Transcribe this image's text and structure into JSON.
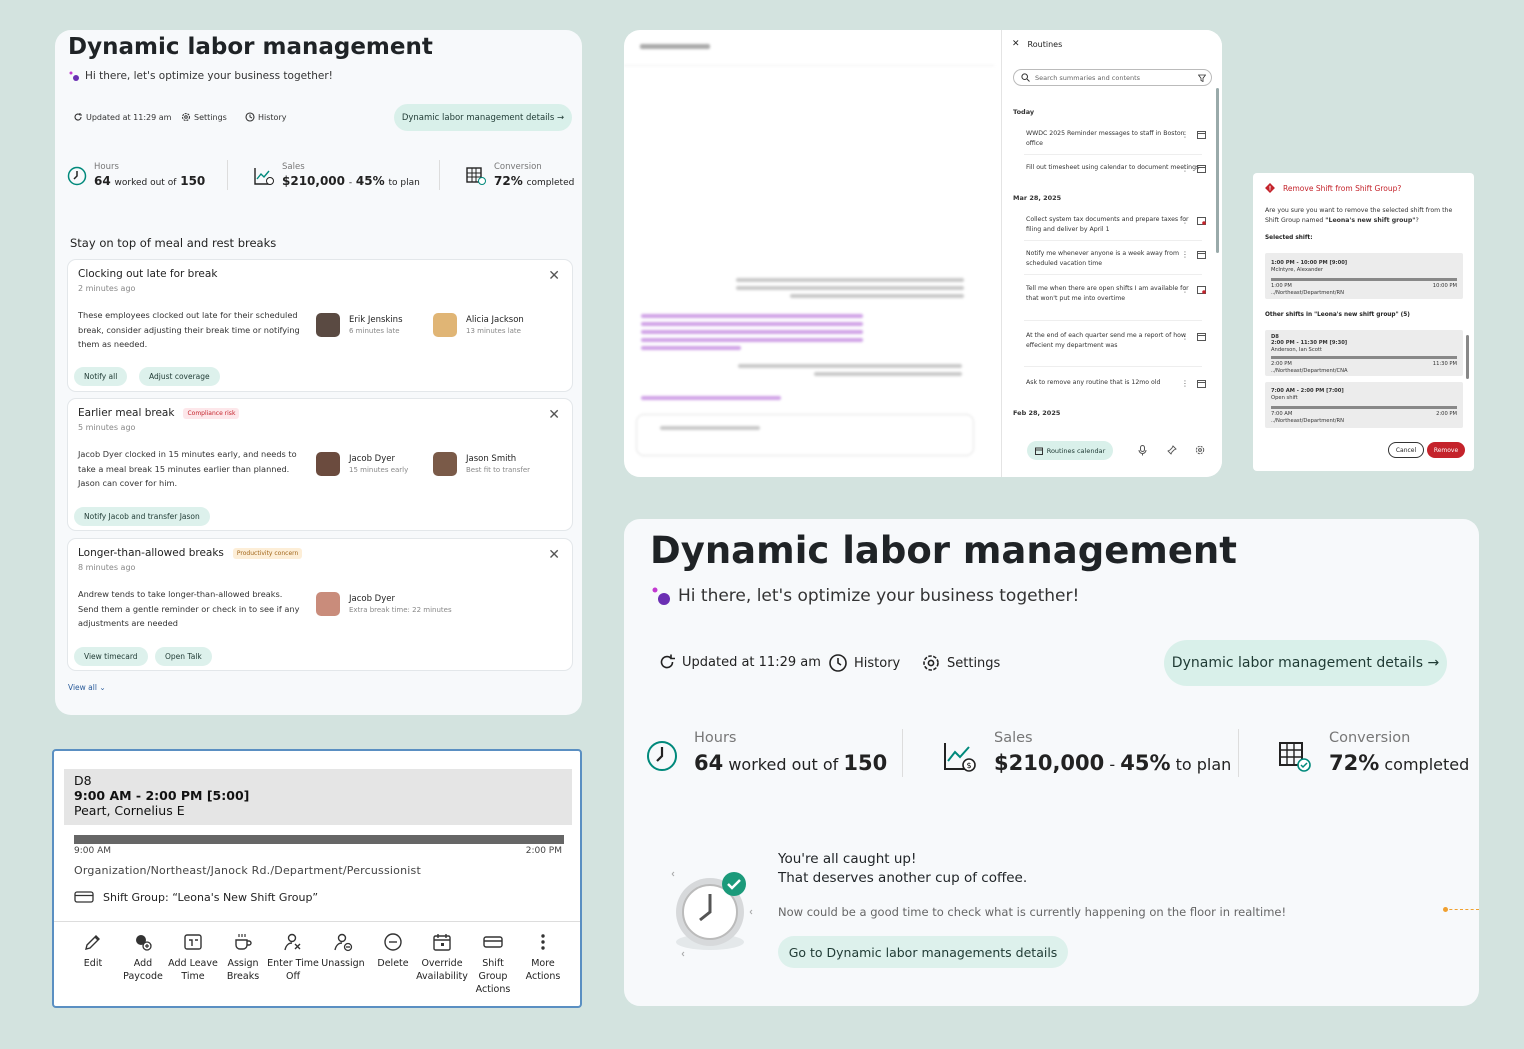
{
  "colors": {
    "accent_mint": "#d9f0ea",
    "brand_purple": "#6b2fb3",
    "danger": "#c4232b",
    "teal": "#00897b"
  },
  "card1": {
    "title": "Dynamic labor management",
    "subtitle": "Hi there, let's optimize your business together!",
    "toolbar": {
      "updated": "Updated at 11:29 am",
      "settings": "Settings",
      "history": "History",
      "details_button": "Dynamic labor management details"
    },
    "stats": {
      "hours": {
        "label": "Hours",
        "value": "64",
        "middle": "worked out of",
        "total": "150"
      },
      "sales": {
        "label": "Sales",
        "value": "$210,000",
        "sep": "-",
        "pct": "45%",
        "suffix": "to plan"
      },
      "conversion": {
        "label": "Conversion",
        "value": "72%",
        "suffix": "completed"
      }
    },
    "section_title": "Stay on top of meal and rest breaks",
    "alerts": [
      {
        "title": "Clocking out late for break",
        "tag": "",
        "time": "2 minutes ago",
        "desc": "These employees clocked out late for their scheduled break, consider adjusting their break time or notifying them as needed.",
        "people": [
          {
            "name": "Erik Jenskins",
            "detail": "6 minutes late"
          },
          {
            "name": "Alicia Jackson",
            "detail": "13 minutes late"
          }
        ],
        "actions": [
          "Notify all",
          "Adjust coverage"
        ]
      },
      {
        "title": "Earlier meal break",
        "tag": "Compliance risk",
        "time": "5 minutes ago",
        "desc": "Jacob Dyer clocked in 15 minutes early, and needs to take a meal break 15 minutes earlier than planned. Jason can cover for him.",
        "people": [
          {
            "name": "Jacob Dyer",
            "detail": "15 minutes early"
          },
          {
            "name": "Jason Smith",
            "detail": "Best fit to transfer"
          }
        ],
        "actions": [
          "Notify Jacob and transfer Jason"
        ]
      },
      {
        "title": "Longer-than-allowed breaks",
        "tag": "Productivity concern",
        "time": "8 minutes ago",
        "desc": "Andrew tends to take longer-than-allowed breaks. Send them a gentle reminder or check in to see if any adjustments are needed",
        "people": [
          {
            "name": "Jacob Dyer",
            "detail": "Extra break time: 22 minutes"
          }
        ],
        "actions": [
          "View timecard",
          "Open Talk"
        ]
      }
    ],
    "view_all": "View all"
  },
  "card2": {
    "panel_title": "Routines",
    "search_placeholder": "Search summaries and contents",
    "groups": [
      {
        "label": "Today",
        "items": [
          "WWDC 2025 Reminder messages to staff in Boston office",
          "Fill out timesheet using calendar to document meetings"
        ]
      },
      {
        "label": "Mar 28, 2025",
        "items": [
          "Collect system tax documents and prepare taxes for filing and deliver by April 1",
          "Notify me whenever anyone is a week away from scheduled vacation time",
          "Tell me when there are open shifts I am available for that won't put me into overtime",
          "At the end of each quarter send me a report of how effecient my department was",
          "Ask to remove any routine that is 12mo old"
        ]
      },
      {
        "label": "Feb 28, 2025",
        "items": []
      }
    ],
    "calendar_button": "Routines calendar"
  },
  "dialog": {
    "title": "Remove Shift from Shift Group?",
    "body_prefix": "Are you sure you want to remove the selected shift from the Shift Group named ",
    "body_group": "\"Leona's new shift group\"",
    "body_suffix": "?",
    "selected_label": "Selected shift:",
    "selected": {
      "time": "1:00 PM - 10:00 PM [9:00]",
      "name": "McIntyre, Alexander",
      "start": "1:00 PM",
      "end": "10:00 PM",
      "path": "../Northeast/Department/RN"
    },
    "other_label": "Other shifts in \"Leona's new shift group\" (5)",
    "others": [
      {
        "code": "D8",
        "time": "2:00 PM - 11:30 PM [9:30]",
        "name": "Anderson, Ian Scott",
        "start": "2:00 PM",
        "end": "11:30 PM",
        "path": "../Northeast/Department/CNA"
      },
      {
        "code": "",
        "time": "7:00 AM - 2:00 PM [7:00]",
        "name": "Open shift",
        "start": "7:00 AM",
        "end": "2:00 PM",
        "path": "../Northeast/Department/RN"
      }
    ],
    "cancel": "Cancel",
    "remove": "Remove"
  },
  "shift": {
    "code": "D8",
    "time": "9:00 AM - 2:00 PM [5:00]",
    "name": "Peart, Cornelius E",
    "start": "9:00 AM",
    "end": "2:00 PM",
    "path": "Organization/Northeast/Janock Rd./Department/Percussionist",
    "group": "Shift Group: “Leona's New Shift Group”",
    "actions": [
      "Edit",
      "Add Paycode",
      "Add Leave Time",
      "Assign Breaks",
      "Enter Time Off",
      "Unassign",
      "Delete",
      "Override Availability",
      "Shift Group Actions",
      "More Actions"
    ]
  },
  "card5": {
    "title": "Dynamic labor management",
    "subtitle": "Hi there, let's optimize your business together!",
    "toolbar": {
      "updated": "Updated at 11:29 am",
      "history": "History",
      "settings": "Settings",
      "details_button": "Dynamic labor management details"
    },
    "stats": {
      "hours": {
        "label": "Hours",
        "value": "64",
        "middle": "worked out of",
        "total": "150"
      },
      "sales": {
        "label": "Sales",
        "value": "$210,000",
        "sep": "-",
        "pct": "45%",
        "suffix": "to plan"
      },
      "conversion": {
        "label": "Conversion",
        "value": "72%",
        "suffix": "completed"
      }
    },
    "caught_up_1": "You're all caught up!",
    "caught_up_2": "That deserves another cup of coffee.",
    "caught_up_desc": "Now could be a good time to check what is currently happening on the floor in realtime!",
    "go_button": "Go to Dynamic labor managements details"
  }
}
